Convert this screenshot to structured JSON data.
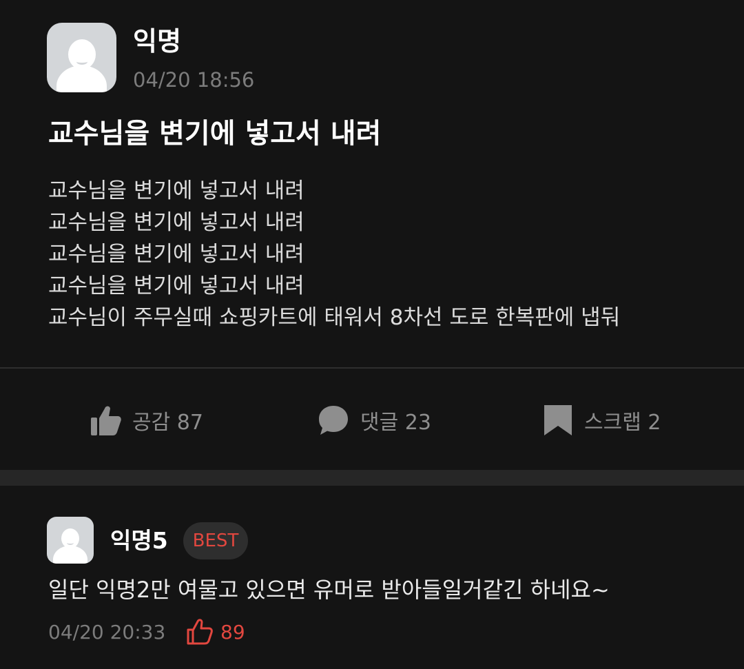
{
  "post": {
    "author": "익명",
    "timestamp": "04/20 18:56",
    "title": "교수님을 변기에 넣고서 내려",
    "content_lines": [
      "교수님을 변기에 넣고서 내려",
      "교수님을 변기에 넣고서 내려",
      "교수님을 변기에 넣고서 내려",
      "교수님을 변기에 넣고서 내려",
      "교수님이 주무실때 쇼핑카트에 태워서 8차선 도로 한복판에 냅둬"
    ],
    "actions": {
      "like": {
        "label": "공감 87",
        "icon": "thumbs-up-icon"
      },
      "comment": {
        "label": "댓글 23",
        "icon": "speech-bubble-icon"
      },
      "scrap": {
        "label": "스크랩 2",
        "icon": "bookmark-icon"
      }
    }
  },
  "comment": {
    "author": "익명5",
    "badge": "BEST",
    "text": "일단 익명2만 여물고 있으면 유머로 받아들일거같긴 하네요~",
    "timestamp": "04/20 20:33",
    "like_count": "89",
    "like_icon": "thumbs-up-outline-icon"
  },
  "colors": {
    "background": "#141414",
    "section_gap": "#262626",
    "muted_text": "#7c7c7c",
    "action_gray": "#8e8e8e",
    "accent_red": "#e2473f",
    "badge_bg": "#2e2e2e",
    "avatar_bg": "#d3d6d9"
  }
}
